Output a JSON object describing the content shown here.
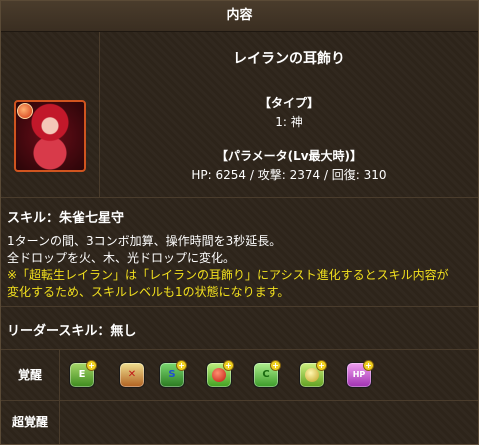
{
  "header": {
    "title": "内容"
  },
  "item": {
    "name": "レイランの耳飾り",
    "type_title": "【タイプ】",
    "type_value": "1: 神",
    "param_title": "【パラメータ(Lv最大時)】",
    "param_value": "HP: 6254 / 攻撃: 2374 / 回復: 310"
  },
  "skill": {
    "title": "スキル：朱雀七星守",
    "lines": [
      "1ターンの間、3コンボ加算、操作時間を3秒延長。",
      "全ドロップを火、木、光ドロップに変化。"
    ],
    "notes": [
      "※「超転生レイラン」は「レイランの耳飾り」にアシスト進化するとスキル内容が",
      "変化するため、スキルレベルも1の状態になります。"
    ]
  },
  "leader": {
    "title": "リーダースキル：無し"
  },
  "awakening": {
    "label": "覚醒",
    "icons": [
      {
        "name": "awakening-e-icon",
        "glyph": "E"
      },
      {
        "name": "awakening-bind-resist-icon",
        "glyph": "✕"
      },
      {
        "name": "awakening-skill-boost-icon",
        "glyph": "S"
      },
      {
        "name": "awakening-fire-orb-icon",
        "glyph": ""
      },
      {
        "name": "awakening-wood-orb-icon",
        "glyph": "C"
      },
      {
        "name": "awakening-light-orb-icon",
        "glyph": ""
      },
      {
        "name": "awakening-hp-plus-icon",
        "glyph": "HP"
      }
    ]
  },
  "super_awakening": {
    "label": "超覚醒"
  }
}
